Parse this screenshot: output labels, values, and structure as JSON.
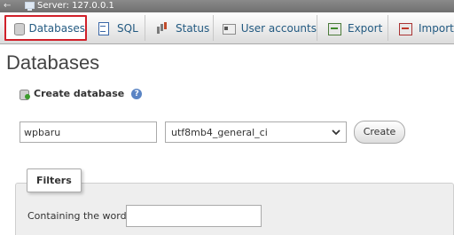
{
  "serverbar": {
    "back_glyph": "←",
    "icon": "server-icon",
    "label": "Server: 127.0.0.1"
  },
  "tabs": [
    {
      "label": "Databases",
      "icon": "database-icon",
      "active": true
    },
    {
      "label": "SQL",
      "icon": "sql-icon",
      "active": false
    },
    {
      "label": "Status",
      "icon": "status-icon",
      "active": false
    },
    {
      "label": "User accounts",
      "icon": "user-accounts-icon",
      "active": false
    },
    {
      "label": "Export",
      "icon": "export-icon",
      "active": false
    },
    {
      "label": "Import",
      "icon": "import-icon",
      "active": false
    }
  ],
  "page": {
    "title": "Databases"
  },
  "create_database": {
    "label": "Create database",
    "help_glyph": "?",
    "name_value": "wpbaru",
    "collation_value": "utf8mb4_general_ci",
    "button_label": "Create"
  },
  "filters": {
    "legend": "Filters",
    "containing_label": "Containing the word:",
    "containing_value": ""
  },
  "colors": {
    "active_tab_border": "#d0202a",
    "link": "#235a81"
  }
}
